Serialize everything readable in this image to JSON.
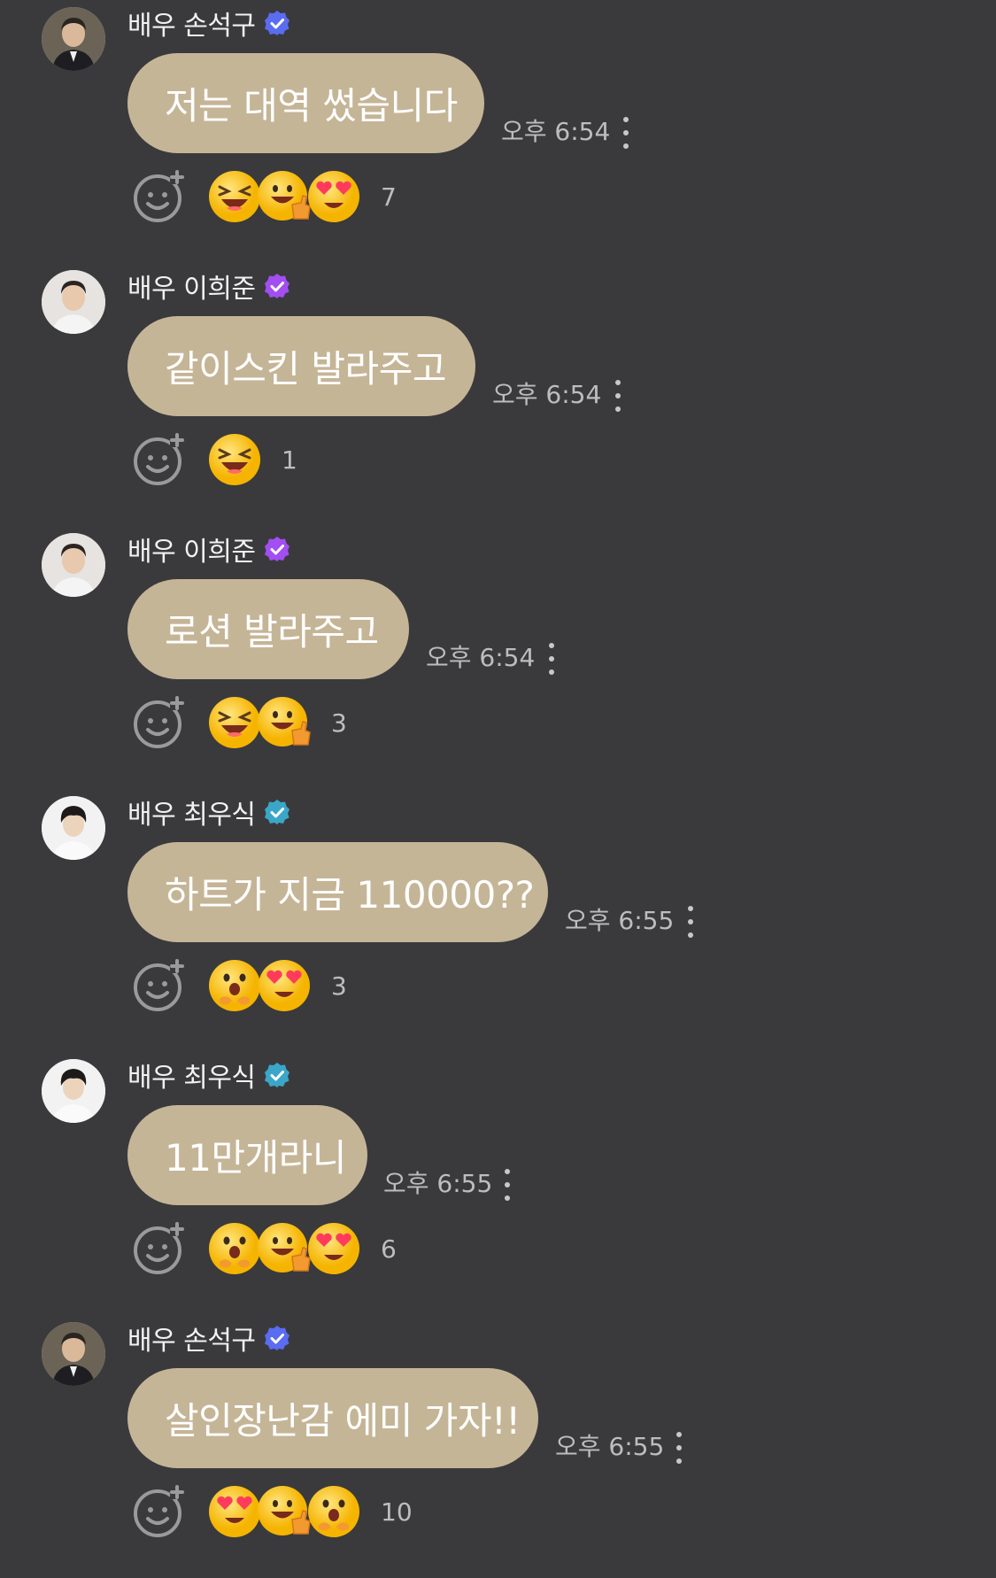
{
  "colors": {
    "background": "#3a3a3d",
    "bubble": "#c5b597",
    "time_text": "#bdbdbd",
    "verified_blue": "#5a6cf0",
    "verified_purple": "#a24ef0",
    "verified_teal": "#3aa7c8"
  },
  "messages": [
    {
      "sender": "배우 손석구",
      "badge": "verified-blue",
      "text": "저는 대역 썼습니다",
      "time": "오후 6:54",
      "reactions": [
        "laughing-face",
        "thumbs-up-face",
        "heart-eyes-face"
      ],
      "reaction_count": "7"
    },
    {
      "sender": "배우 이희준",
      "badge": "verified-purple",
      "text": "같이스킨 발라주고",
      "time": "오후 6:54",
      "reactions": [
        "laughing-face"
      ],
      "reaction_count": "1"
    },
    {
      "sender": "배우 이희준",
      "badge": "verified-purple",
      "text": "로션 발라주고",
      "time": "오후 6:54",
      "reactions": [
        "laughing-face",
        "thumbs-up-face"
      ],
      "reaction_count": "3"
    },
    {
      "sender": "배우 최우식",
      "badge": "verified-teal",
      "text": "하트가 지금 110000??",
      "time": "오후 6:55",
      "reactions": [
        "surprised-face",
        "heart-eyes-face"
      ],
      "reaction_count": "3"
    },
    {
      "sender": "배우 최우식",
      "badge": "verified-teal",
      "text": "11만개라니",
      "time": "오후 6:55",
      "reactions": [
        "surprised-face",
        "thumbs-up-face",
        "heart-eyes-face"
      ],
      "reaction_count": "6"
    },
    {
      "sender": "배우 손석구",
      "badge": "verified-blue",
      "text": "살인장난감 에미 가자!!",
      "time": "오후 6:55",
      "reactions": [
        "heart-eyes-face",
        "thumbs-up-face",
        "surprised-face"
      ],
      "reaction_count": "10"
    }
  ]
}
